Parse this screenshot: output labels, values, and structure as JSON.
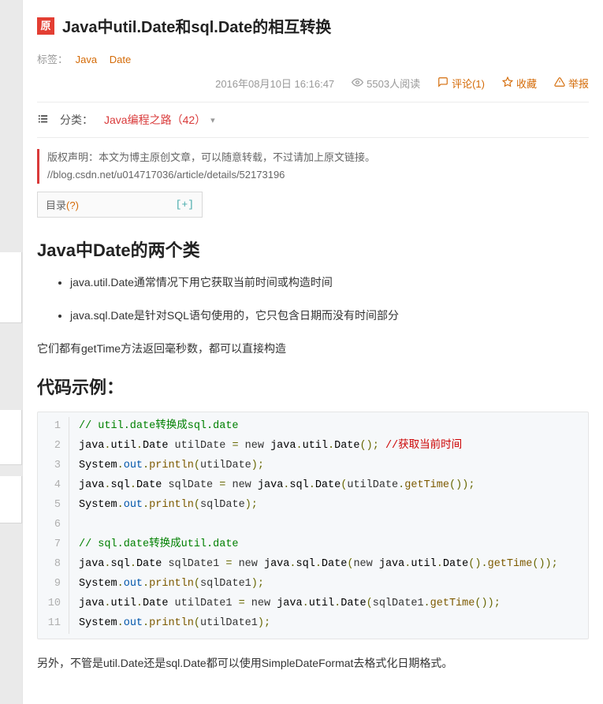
{
  "badge": "原",
  "title": "Java中util.Date和sql.Date的相互转换",
  "tags": {
    "label": "标签：",
    "items": [
      "Java",
      "Date"
    ]
  },
  "meta": {
    "timestamp": "2016年08月10日 16:16:47",
    "views": "5503人阅读",
    "comments": "评论(1)",
    "favorite": "收藏",
    "report": "举报"
  },
  "category": {
    "label": "分类：",
    "value": "Java编程之路（42）"
  },
  "copyright": "版权声明：本文为博主原创文章，可以随意转载，不过请加上原文链接。 //blog.csdn.net/u014717036/article/details/52173196",
  "toc": {
    "label": "目录",
    "q": "(?)",
    "toggle": "[+]"
  },
  "section1_heading": "Java中Date的两个类",
  "bullets": [
    "java.util.Date通常情况下用它获取当前时间或构造时间",
    "java.sql.Date是针对SQL语句使用的，它只包含日期而没有时间部分"
  ],
  "para1": "它们都有getTime方法返回毫秒数，都可以直接构造",
  "section2_heading": "代码示例：",
  "code": [
    {
      "type": "comment",
      "text": "// util.date转换成sql.date"
    },
    {
      "type": "line1",
      "raw": "java.util.Date utilDate = new java.util.Date(); //获取当前时间"
    },
    {
      "type": "print",
      "arg": "utilDate"
    },
    {
      "type": "line4",
      "raw": "java.sql.Date sqlDate = new java.sql.Date(utilDate.getTime());"
    },
    {
      "type": "print",
      "arg": "sqlDate"
    },
    {
      "type": "blank"
    },
    {
      "type": "comment",
      "text": "// sql.date转换成util.date"
    },
    {
      "type": "line8",
      "raw": "java.sql.Date sqlDate1 = new java.sql.Date(new java.util.Date().getTime());"
    },
    {
      "type": "print",
      "arg": "sqlDate1"
    },
    {
      "type": "line10",
      "raw": "java.util.Date utilDate1 = new java.util.Date(sqlDate1.getTime());"
    },
    {
      "type": "print",
      "arg": "utilDate1"
    }
  ],
  "para2": "另外，不管是util.Date还是sql.Date都可以使用SimpleDateFormat去格式化日期格式。"
}
